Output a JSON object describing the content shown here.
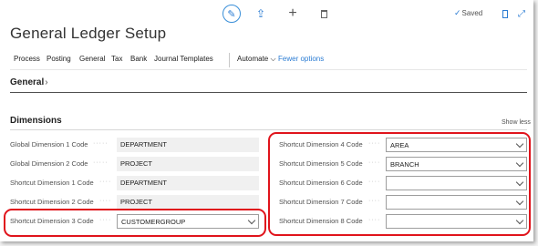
{
  "app": {
    "title": "General Ledger Setup",
    "status": "Saved"
  },
  "icons": {
    "edit": "edit-icon",
    "share": "share-icon",
    "new": "plus-icon",
    "delete": "trash-icon",
    "bookmark": "bookmark-icon",
    "expand": "expand-icon",
    "saved_check": "check-icon"
  },
  "menu": {
    "items": [
      "Process",
      "Posting",
      "General",
      "Tax",
      "Bank",
      "Journal Templates"
    ],
    "automate": "Automate",
    "fewer": "Fewer options"
  },
  "sections": {
    "general": "General",
    "dimensions": "Dimensions",
    "show_less": "Show less"
  },
  "fields_left": [
    {
      "label": "Global Dimension 1 Code",
      "value": "DEPARTMENT",
      "editable": false
    },
    {
      "label": "Global Dimension 2 Code",
      "value": "PROJECT",
      "editable": false
    },
    {
      "label": "Shortcut Dimension 1 Code",
      "value": "DEPARTMENT",
      "editable": false
    },
    {
      "label": "Shortcut Dimension 2 Code",
      "value": "PROJECT",
      "editable": false
    },
    {
      "label": "Shortcut Dimension 3 Code",
      "value": "CUSTOMERGROUP",
      "editable": true
    }
  ],
  "fields_right": [
    {
      "label": "Shortcut Dimension 4 Code",
      "value": "AREA",
      "editable": true
    },
    {
      "label": "Shortcut Dimension 5 Code",
      "value": "BRANCH",
      "editable": true
    },
    {
      "label": "Shortcut Dimension 6 Code",
      "value": "",
      "editable": true
    },
    {
      "label": "Shortcut Dimension 7 Code",
      "value": "",
      "editable": true
    },
    {
      "label": "Shortcut Dimension 8 Code",
      "value": "",
      "editable": true
    }
  ],
  "colors": {
    "accent": "#2b7cd3",
    "highlight": "#e0141c",
    "readonly_bg": "#f0f0f0"
  }
}
